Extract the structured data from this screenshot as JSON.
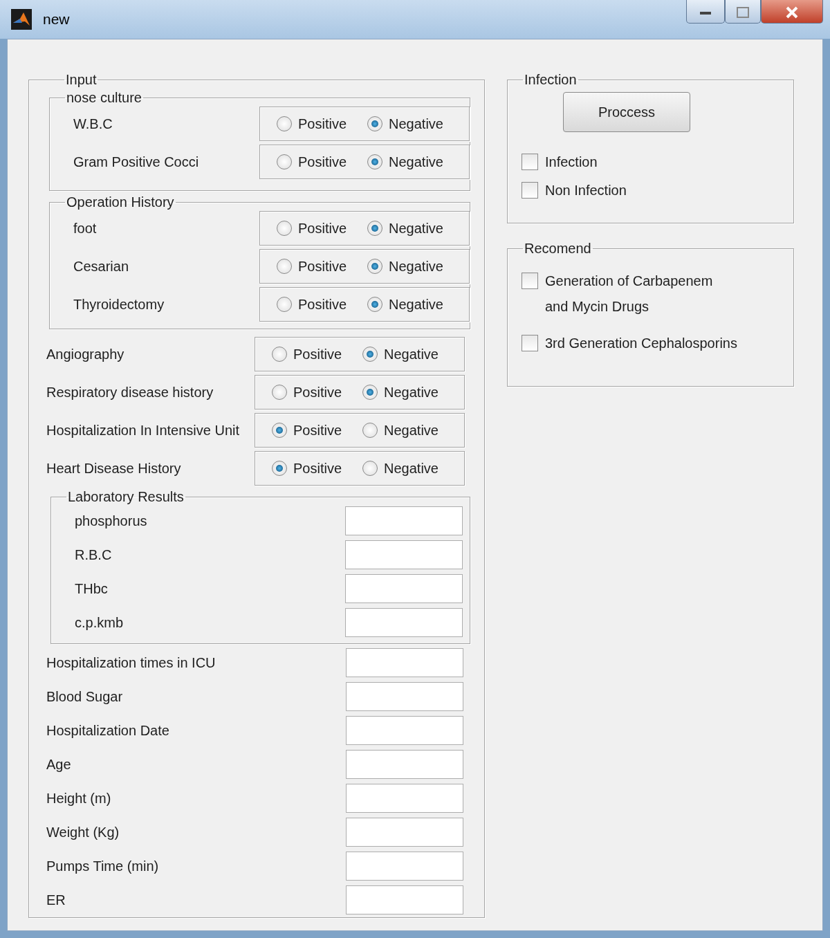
{
  "window": {
    "title": "new"
  },
  "input": {
    "title": "Input",
    "nose_culture": {
      "title": "nose culture",
      "rows": [
        {
          "label": "W.B.C",
          "options": [
            {
              "label": "Positive",
              "selected": false
            },
            {
              "label": "Negative",
              "selected": true
            }
          ]
        },
        {
          "label": "Gram Positive Cocci",
          "options": [
            {
              "label": "Positive",
              "selected": false
            },
            {
              "label": "Negative",
              "selected": true
            }
          ]
        }
      ]
    },
    "operation_history": {
      "title": "Operation History",
      "rows": [
        {
          "label": "foot",
          "options": [
            {
              "label": "Positive",
              "selected": false
            },
            {
              "label": "Negative",
              "selected": true
            }
          ]
        },
        {
          "label": "Cesarian",
          "options": [
            {
              "label": "Positive",
              "selected": false
            },
            {
              "label": "Negative",
              "selected": true
            }
          ]
        },
        {
          "label": "Thyroidectomy",
          "options": [
            {
              "label": "Positive",
              "selected": false
            },
            {
              "label": "Negative",
              "selected": true
            }
          ]
        }
      ]
    },
    "rows": [
      {
        "label": "Angiography",
        "options": [
          {
            "label": "Positive",
            "selected": false
          },
          {
            "label": "Negative",
            "selected": true
          }
        ]
      },
      {
        "label": "Respiratory disease history",
        "options": [
          {
            "label": "Positive",
            "selected": false
          },
          {
            "label": "Negative",
            "selected": true
          }
        ]
      },
      {
        "label": "Hospitalization In Intensive Unit",
        "options": [
          {
            "label": "Positive",
            "selected": true
          },
          {
            "label": "Negative",
            "selected": false
          }
        ]
      },
      {
        "label": "Heart Disease History",
        "options": [
          {
            "label": "Positive",
            "selected": true
          },
          {
            "label": "Negative",
            "selected": false
          }
        ]
      }
    ],
    "laboratory_results": {
      "title": "Laboratory Results",
      "fields": [
        {
          "label": "phosphorus"
        },
        {
          "label": "R.B.C"
        },
        {
          "label": "THbc"
        },
        {
          "label": "c.p.kmb"
        }
      ]
    },
    "fields": [
      {
        "label": "Hospitalization times in ICU"
      },
      {
        "label": "Blood Sugar"
      },
      {
        "label": "Hospitalization Date"
      },
      {
        "label": "Age"
      },
      {
        "label": "Height (m)"
      },
      {
        "label": "Weight (Kg)"
      },
      {
        "label": "Pumps Time (min)"
      },
      {
        "label": "ER"
      }
    ]
  },
  "infection": {
    "title": "Infection",
    "button": "Proccess",
    "checks": [
      {
        "label": "Infection",
        "checked": false
      },
      {
        "label": "Non Infection",
        "checked": false
      }
    ]
  },
  "recommend": {
    "title": "Recomend",
    "checks": [
      {
        "label": "Generation of Carbapenem\nand Mycin Drugs",
        "checked": false
      },
      {
        "label": "3rd Generation Cephalosporins",
        "checked": false
      }
    ]
  }
}
